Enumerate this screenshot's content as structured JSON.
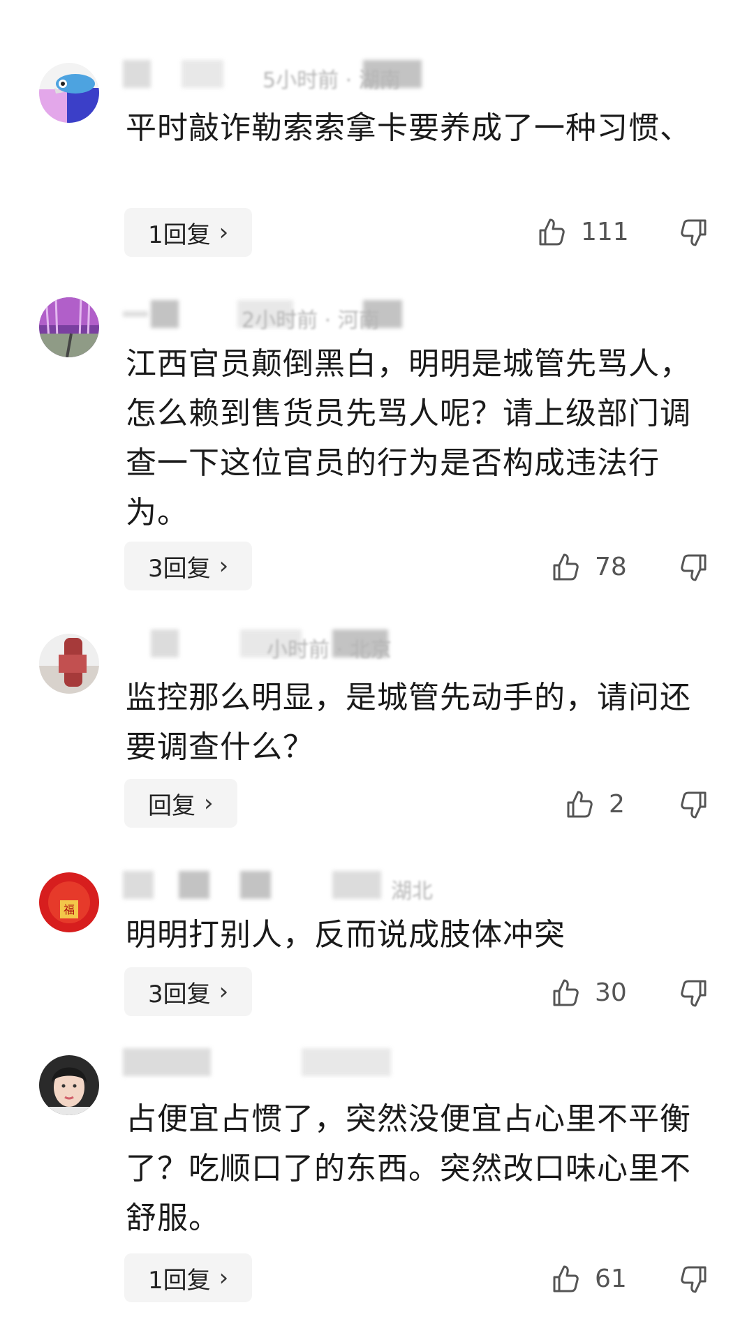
{
  "comments": [
    {
      "meta": "5小时前 · 湖南",
      "text": "平时敲诈勒索索拿卡要养成了一种习惯、",
      "reply_label": "1回复",
      "likes": "111",
      "avatar": "blue-bird"
    },
    {
      "meta": "2小时前 · 河南",
      "text": "江西官员颠倒黑白，明明是城管先骂人，怎么赖到售货员先骂人呢？请上级部门调查一下这位官员的行为是否构成违法行为。",
      "reply_label": "3回复",
      "likes": "78",
      "avatar": "purple-forest"
    },
    {
      "meta": "小时前 · 北京",
      "text": "监控那么明显，是城管先动手的，请问还要调查什么？",
      "reply_label": "回复",
      "likes": "2",
      "avatar": "red-figure"
    },
    {
      "meta": "湖北",
      "text": "明明打别人，反而说成肢体冲突",
      "reply_label": "3回复",
      "likes": "30",
      "avatar": "red-new-year"
    },
    {
      "meta": "",
      "text": "占便宜占惯了，突然没便宜占心里不平衡了？吃顺口了的东西。突然改口味心里不舒服。",
      "reply_label": "1回复",
      "likes": "61",
      "avatar": "portrait-woman"
    }
  ],
  "icons": {
    "like": "thumbs-up-icon",
    "dislike": "thumbs-down-icon",
    "chevron": "chevron-right-icon"
  },
  "colors": {
    "text": "#1a1a1a",
    "muted": "#555555",
    "reply_bg": "#f4f4f4"
  }
}
